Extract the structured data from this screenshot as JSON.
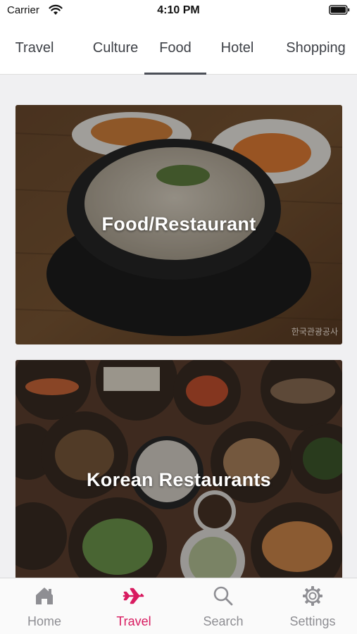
{
  "status_bar": {
    "carrier": "Carrier",
    "time": "4:10 PM"
  },
  "tabs": [
    {
      "label": "Travel",
      "active": false
    },
    {
      "label": "Culture",
      "active": false
    },
    {
      "label": "Food",
      "active": true
    },
    {
      "label": "Hotel",
      "active": false
    },
    {
      "label": "Shopping",
      "active": false
    }
  ],
  "cards": [
    {
      "title": "Food/Restaurant",
      "watermark": "한국관광공사"
    },
    {
      "title": "Korean Restaurants"
    }
  ],
  "bottom_nav": [
    {
      "label": "Home",
      "icon": "home-icon",
      "active": false
    },
    {
      "label": "Travel",
      "icon": "airplane-icon",
      "active": true
    },
    {
      "label": "Search",
      "icon": "search-icon",
      "active": false
    },
    {
      "label": "Settings",
      "icon": "gear-icon",
      "active": false
    }
  ],
  "colors": {
    "accent": "#d81b60",
    "inactive": "#8e8e93",
    "tab_text": "#3e4147"
  }
}
